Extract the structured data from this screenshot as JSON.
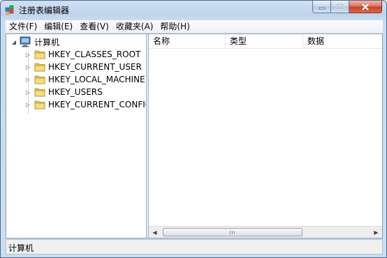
{
  "window": {
    "title": "注册表编辑器"
  },
  "menu": [
    {
      "label": "文件(F)"
    },
    {
      "label": "编辑(E)"
    },
    {
      "label": "查看(V)"
    },
    {
      "label": "收藏夹(A)"
    },
    {
      "label": "帮助(H)"
    }
  ],
  "tree": {
    "root": {
      "label": "计算机",
      "icon": "computer-icon",
      "expanded": true
    },
    "children": [
      {
        "label": "HKEY_CLASSES_ROOT",
        "icon": "folder-icon"
      },
      {
        "label": "HKEY_CURRENT_USER",
        "icon": "folder-icon"
      },
      {
        "label": "HKEY_LOCAL_MACHINE",
        "icon": "folder-icon"
      },
      {
        "label": "HKEY_USERS",
        "icon": "folder-icon"
      },
      {
        "label": "HKEY_CURRENT_CONFIG",
        "icon": "folder-icon"
      }
    ]
  },
  "list": {
    "columns": [
      {
        "label": "名称"
      },
      {
        "label": "类型"
      },
      {
        "label": "数据"
      }
    ]
  },
  "status": {
    "path": "计算机"
  },
  "colors": {
    "titlebar": "#bfd4ec",
    "folder": "#e9c45a",
    "close_button": "#c0412a"
  }
}
